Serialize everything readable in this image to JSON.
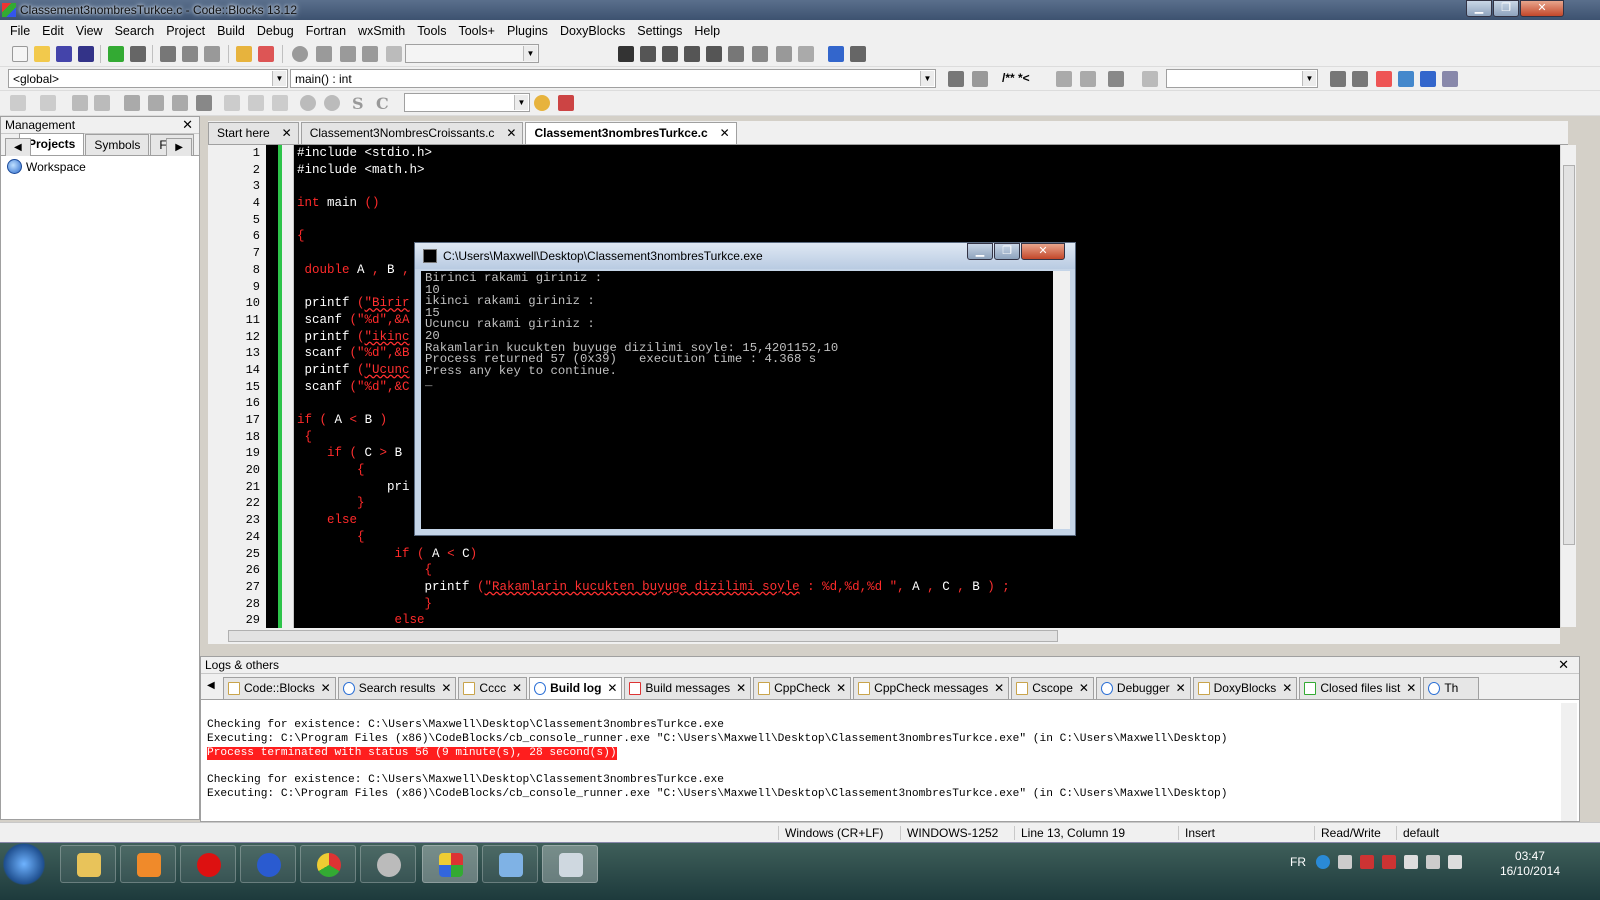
{
  "window": {
    "title": "Classement3nombresTurkce.c - Code::Blocks 13.12"
  },
  "menu": [
    "File",
    "Edit",
    "View",
    "Search",
    "Project",
    "Build",
    "Debug",
    "Fortran",
    "wxSmith",
    "Tools",
    "Tools+",
    "Plugins",
    "DoxyBlocks",
    "Settings",
    "Help"
  ],
  "toolbar2": {
    "scope": "<global>",
    "function": "main() : int",
    "doc_comment": "/** *<"
  },
  "toolbar3": {
    "s_label": "S",
    "c_label": "C"
  },
  "management": {
    "title": "Management",
    "tabs": [
      "Projects",
      "Symbols",
      "Files"
    ],
    "tree_root": "Workspace"
  },
  "editor": {
    "tabs": [
      "Start here",
      "Classement3NombresCroissants.c",
      "Classement3nombresTurkce.c"
    ],
    "line_numbers": [
      "1",
      "2",
      "3",
      "4",
      "5",
      "6",
      "7",
      "8",
      "9",
      "10",
      "11",
      "12",
      "13",
      "14",
      "15",
      "16",
      "17",
      "18",
      "19",
      "20",
      "21",
      "22",
      "23",
      "24",
      "25",
      "26",
      "27",
      "28",
      "29"
    ],
    "lines": [
      [
        {
          "t": "#include <stdio.h>",
          "c": "w"
        }
      ],
      [
        {
          "t": "#include <math.h>",
          "c": "w"
        }
      ],
      [],
      [
        {
          "t": "int",
          "c": "kw"
        },
        {
          "t": " main ",
          "c": "w"
        },
        {
          "t": "()",
          "c": "kw"
        }
      ],
      [],
      [
        {
          "t": "{",
          "c": "kw"
        }
      ],
      [],
      [
        {
          "t": " double",
          "c": "kw"
        },
        {
          "t": " A ",
          "c": "w"
        },
        {
          "t": ",",
          "c": "op"
        },
        {
          "t": " B ",
          "c": "w"
        },
        {
          "t": ",",
          "c": "op"
        }
      ],
      [],
      [
        {
          "t": " printf ",
          "c": "w"
        },
        {
          "t": "(",
          "c": "op"
        },
        {
          "t": "\"Birir",
          "c": "str"
        }
      ],
      [
        {
          "t": " scanf ",
          "c": "w"
        },
        {
          "t": "(",
          "c": "op"
        },
        {
          "t": "\"%d\"",
          "c": "kw"
        },
        {
          "t": ",&A",
          "c": "op"
        }
      ],
      [
        {
          "t": " printf ",
          "c": "w"
        },
        {
          "t": "(",
          "c": "op"
        },
        {
          "t": "\"ikinc",
          "c": "str"
        }
      ],
      [
        {
          "t": " scanf ",
          "c": "w"
        },
        {
          "t": "(",
          "c": "op"
        },
        {
          "t": "\"%d\"",
          "c": "kw"
        },
        {
          "t": ",&B",
          "c": "op"
        }
      ],
      [
        {
          "t": " printf ",
          "c": "w"
        },
        {
          "t": "(",
          "c": "op"
        },
        {
          "t": "\"Ucunc",
          "c": "str"
        }
      ],
      [
        {
          "t": " scanf ",
          "c": "w"
        },
        {
          "t": "(",
          "c": "op"
        },
        {
          "t": "\"%d\"",
          "c": "kw"
        },
        {
          "t": ",&C",
          "c": "op"
        }
      ],
      [],
      [
        {
          "t": "if",
          "c": "kw"
        },
        {
          "t": " ( ",
          "c": "op"
        },
        {
          "t": "A ",
          "c": "w"
        },
        {
          "t": "<",
          "c": "op"
        },
        {
          "t": " B ",
          "c": "w"
        },
        {
          "t": ")",
          "c": "op"
        }
      ],
      [
        {
          "t": " {",
          "c": "kw"
        }
      ],
      [
        {
          "t": "    if",
          "c": "kw"
        },
        {
          "t": " ( ",
          "c": "op"
        },
        {
          "t": "C ",
          "c": "w"
        },
        {
          "t": ">",
          "c": "op"
        },
        {
          "t": " B",
          "c": "w"
        }
      ],
      [
        {
          "t": "        {",
          "c": "kw"
        }
      ],
      [
        {
          "t": "            pri",
          "c": "w"
        }
      ],
      [
        {
          "t": "        }",
          "c": "kw"
        }
      ],
      [
        {
          "t": "    else",
          "c": "kw"
        }
      ],
      [
        {
          "t": "        {",
          "c": "kw"
        }
      ],
      [
        {
          "t": "             if",
          "c": "kw"
        },
        {
          "t": " ( ",
          "c": "op"
        },
        {
          "t": "A ",
          "c": "w"
        },
        {
          "t": "<",
          "c": "op"
        },
        {
          "t": " C",
          "c": "w"
        },
        {
          "t": ")",
          "c": "op"
        }
      ],
      [
        {
          "t": "                 {",
          "c": "kw"
        }
      ],
      [
        {
          "t": "                 printf ",
          "c": "w"
        },
        {
          "t": "(",
          "c": "op"
        },
        {
          "t": "\"Rakamlarin kucukten buyuge dizilimi soyle",
          "c": "str"
        },
        {
          "t": " : %d,%d,%d \"",
          "c": "kw"
        },
        {
          "t": ", ",
          "c": "op"
        },
        {
          "t": "A ",
          "c": "w"
        },
        {
          "t": ",",
          "c": "op"
        },
        {
          "t": " C ",
          "c": "w"
        },
        {
          "t": ",",
          "c": "op"
        },
        {
          "t": " B ",
          "c": "w"
        },
        {
          "t": ") ;",
          "c": "op"
        }
      ],
      [
        {
          "t": "                 }",
          "c": "kw"
        }
      ],
      [
        {
          "t": "             else",
          "c": "kw"
        }
      ]
    ]
  },
  "console": {
    "title": "C:\\Users\\Maxwell\\Desktop\\Classement3nombresTurkce.exe",
    "output": "Birinci rakami giriniz :\n10\nikinci rakami giriniz :\n15\nUcuncu rakami giriniz :\n20\nRakamlarin kucukten buyuge dizilimi soyle: 15,4201152,10\nProcess returned 57 (0x39)   execution time : 4.368 s\nPress any key to continue.\n_"
  },
  "logs": {
    "title": "Logs & others",
    "tabs": [
      "Code::Blocks",
      "Search results",
      "Cccc",
      "Build log",
      "Build messages",
      "CppCheck",
      "CppCheck messages",
      "Cscope",
      "Debugger",
      "DoxyBlocks",
      "Closed files list",
      "Th"
    ],
    "lines": [
      {
        "text": "Checking for existence: C:\\Users\\Maxwell\\Desktop\\Classement3nombresTurkce.exe",
        "error": false
      },
      {
        "text": "Executing: C:\\Program Files (x86)\\CodeBlocks/cb_console_runner.exe \"C:\\Users\\Maxwell\\Desktop\\Classement3nombresTurkce.exe\" (in C:\\Users\\Maxwell\\Desktop)",
        "error": false
      },
      {
        "text": "Process terminated with status 56 (9 minute(s), 28 second(s))",
        "error": true
      },
      {
        "text": "",
        "error": false
      },
      {
        "text": "Checking for existence: C:\\Users\\Maxwell\\Desktop\\Classement3nombresTurkce.exe",
        "error": false
      },
      {
        "text": "Executing: C:\\Program Files (x86)\\CodeBlocks/cb_console_runner.exe \"C:\\Users\\Maxwell\\Desktop\\Classement3nombresTurkce.exe\" (in C:\\Users\\Maxwell\\Desktop)",
        "error": false
      }
    ]
  },
  "status": {
    "eol": "Windows (CR+LF)",
    "encoding": "WINDOWS-1252",
    "position": "Line 13, Column 19",
    "mode": "Insert",
    "access": "Read/Write",
    "profile": "default"
  },
  "taskbar": {
    "language": "FR",
    "time": "03:47",
    "date": "16/10/2014"
  },
  "colors": {
    "accent_green": "#2ec44a",
    "error_bg": "#ff1e1e",
    "keyword": "#ff2a2a"
  }
}
